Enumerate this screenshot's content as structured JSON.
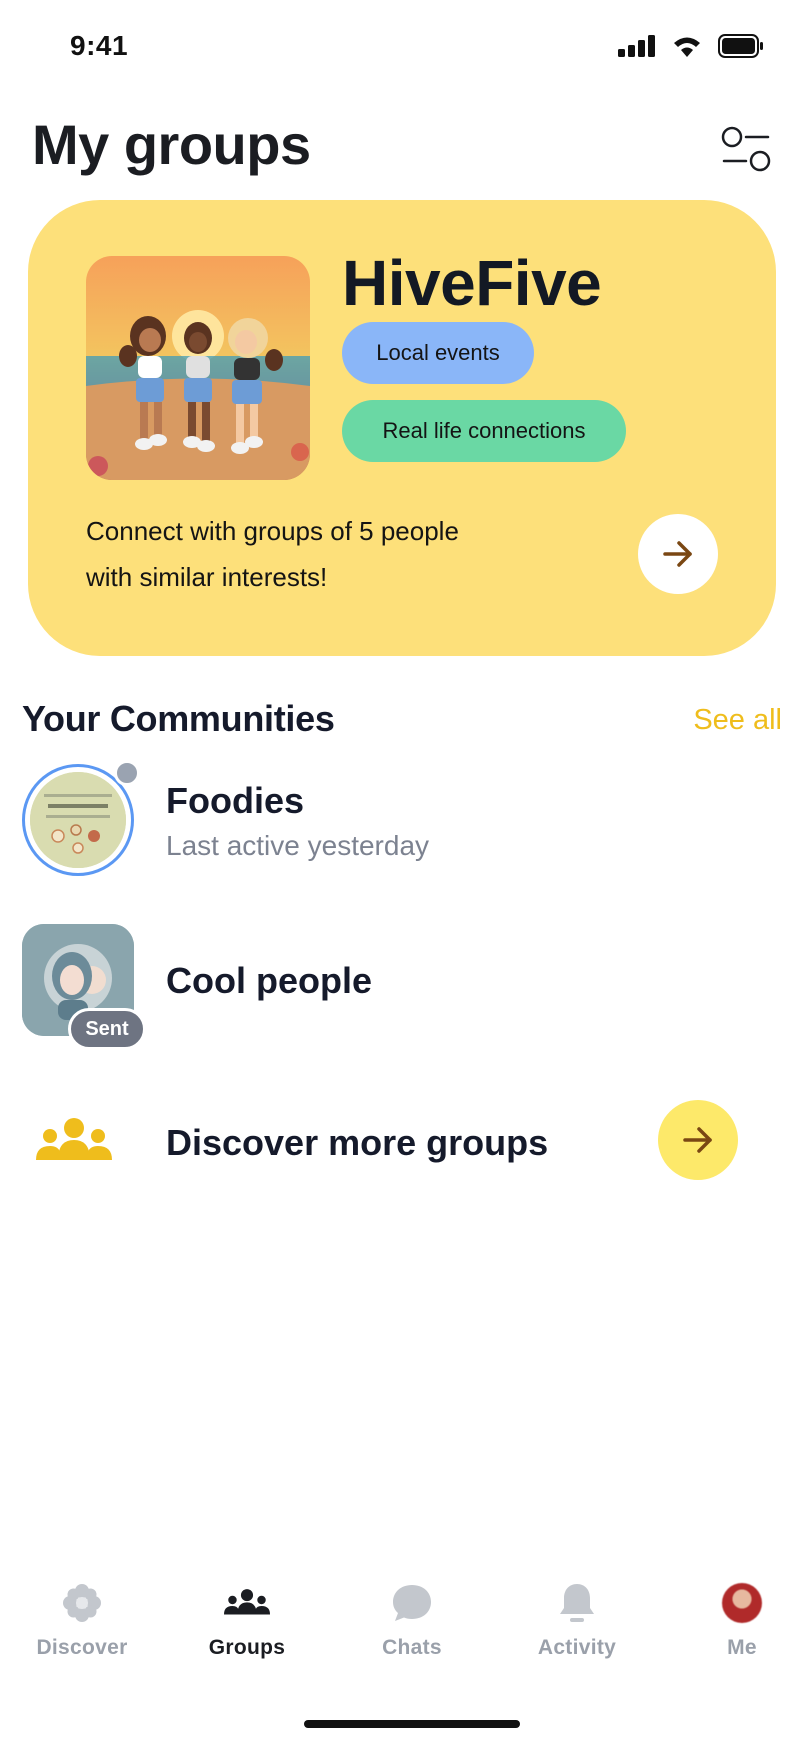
{
  "status_bar": {
    "time": "9:41"
  },
  "header": {
    "title": "My groups"
  },
  "promo": {
    "title": "HiveFive",
    "tags": [
      "Local events",
      "Real life connections"
    ],
    "description": "Connect with groups of 5 people with similar interests!"
  },
  "communities": {
    "title": "Your Communities",
    "see_all": "See all",
    "items": [
      {
        "name": "Foodies",
        "subtitle": "Last active yesterday"
      },
      {
        "name": "Cool people",
        "badge": "Sent"
      }
    ],
    "discover": {
      "label": "Discover more groups"
    }
  },
  "tabs": [
    {
      "label": "Discover",
      "icon": "flower-icon"
    },
    {
      "label": "Groups",
      "icon": "people-icon",
      "active": true
    },
    {
      "label": "Chats",
      "icon": "chat-bubble-icon"
    },
    {
      "label": "Activity",
      "icon": "bell-icon"
    },
    {
      "label": "Me",
      "icon": "profile-avatar"
    }
  ],
  "colors": {
    "promo_bg": "#fde07a",
    "accent_yellow": "#efbd1c",
    "tag_blue": "#8ab6f8",
    "tag_green": "#6ad8a4",
    "online_ring": "#5b98f3"
  }
}
